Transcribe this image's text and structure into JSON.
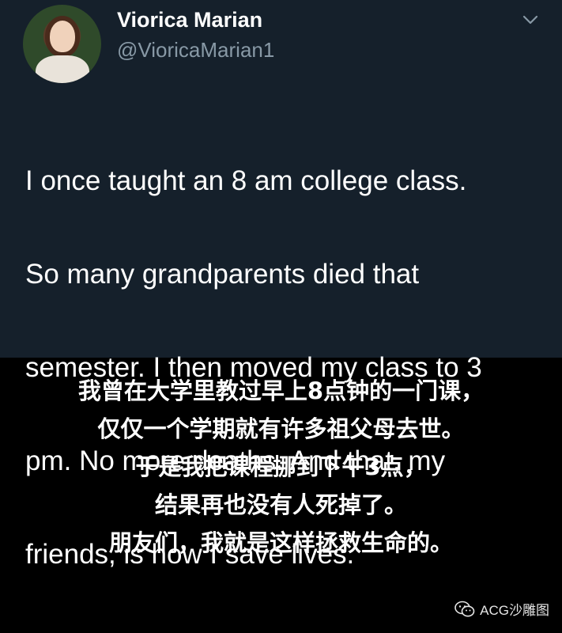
{
  "tweet": {
    "display_name": "Viorica Marian",
    "handle": "@VioricaMarian1",
    "text_lines": [
      "I once taught an 8 am college class.",
      "So many grandparents died that",
      "semester. I then moved my class to 3",
      "pm. No more deaths. And that, my",
      "friends, is how I save lives."
    ],
    "colors": {
      "background": "#15202b",
      "text": "#ffffff",
      "secondary": "#8899a6"
    },
    "icons": {
      "menu": "chevron-down-icon",
      "avatar": "avatar"
    }
  },
  "caption": {
    "lines": [
      "我曾在大学里教过早上8点钟的一门课，",
      "仅仅一个学期就有许多祖父母去世。",
      "于是我把课程挪到下午3点，",
      "结果再也没有人死掉了。",
      "朋友们，我就是这样拯救生命的。"
    ],
    "background": "#000000"
  },
  "watermark": {
    "text": "ACG沙雕图",
    "icon": "wechat-icon"
  }
}
